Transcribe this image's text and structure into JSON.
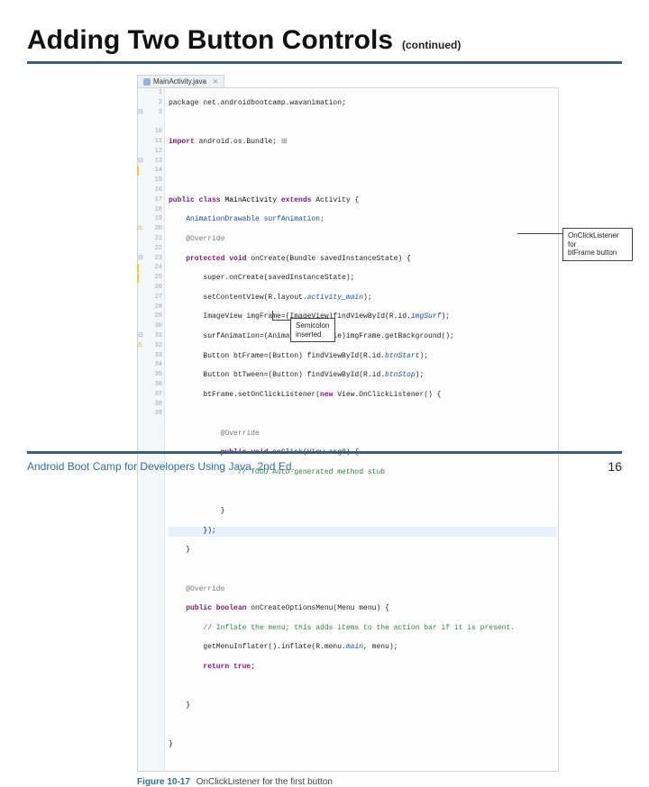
{
  "header": {
    "title": "Adding Two Button Controls",
    "continued": "(continued)"
  },
  "tab": {
    "filename": "MainActivity.java"
  },
  "gutter": [
    "1",
    "2",
    "3",
    "",
    "10",
    "11",
    "12",
    "13",
    "14",
    "15",
    "16",
    "17",
    "18",
    "19",
    "20",
    "21",
    "22",
    "23",
    "24",
    "25",
    "26",
    "27",
    "28",
    "29",
    "30",
    "31",
    "32",
    "33",
    "34",
    "35",
    "36",
    "37",
    "38",
    "39"
  ],
  "code": {
    "l1": "package net.androidbootcamp.wavanimation;",
    "l3a": "import",
    "l3b": " android.os.Bundle;",
    "l11a": "public class ",
    "l11b": "MainActivity ",
    "l11c": "extends ",
    "l11d": "Activity {",
    "l12": "    AnimationDrawable surfAnimation;",
    "l13": "    @Override",
    "l14a": "    protected void ",
    "l14b": "onCreate(Bundle savedInstanceState) {",
    "l15": "        super.onCreate(savedInstanceState);",
    "l16a": "        setContentView(R.layout.",
    "l16b": "activity_main",
    "l16c": ");",
    "l17a": "        ImageView imgFrame=(ImageView)findViewById(R.id.",
    "l17b": "imgSurf",
    "l17c": ");",
    "l18": "        surfAnimation=(AnimationDrawable)imgFrame.getBackground();",
    "l19a": "        Button btFrame=(Button) findViewById(R.id.",
    "l19b": "btnStart",
    "l19c": ");",
    "l20a": "        Button btTween=(Button) findViewById(R.id.",
    "l20b": "btnStop",
    "l20c": ");",
    "l21a": "        btFrame.setOnClickListener(",
    "l21b": "new",
    "l21c": " View.OnClickListener() {",
    "l23": "            @Override",
    "l24a": "            public void ",
    "l24b": "onClick(View arg0) {",
    "l25": "                // TODO Auto-generated method stub",
    "l27": "            }",
    "l28": "        });",
    "l29": "    }",
    "l31": "    @Override",
    "l32a": "    public boolean ",
    "l32b": "onCreateOptionsMenu(Menu menu) {",
    "l33": "        // Inflate the menu; this adds items to the action bar if it is present.",
    "l34a": "        getMenuInflater().inflate(R.menu.",
    "l34b": "main",
    "l34c": ", menu);",
    "l35a": "        return ",
    "l35b": "true",
    "l35c": ";",
    "l37": "    }",
    "l39": "}"
  },
  "callouts": {
    "right_line1": "OnClickListener for",
    "right_line2": "btFrame button",
    "semicolon_line1": "Semicolon",
    "semicolon_line2": "inserted"
  },
  "figure": {
    "number": "Figure 10-17",
    "text": "OnClickListener for the first button"
  },
  "footer": {
    "left": "Android Boot Camp for Developers Using Java, 2nd Ed.",
    "page": "16"
  }
}
